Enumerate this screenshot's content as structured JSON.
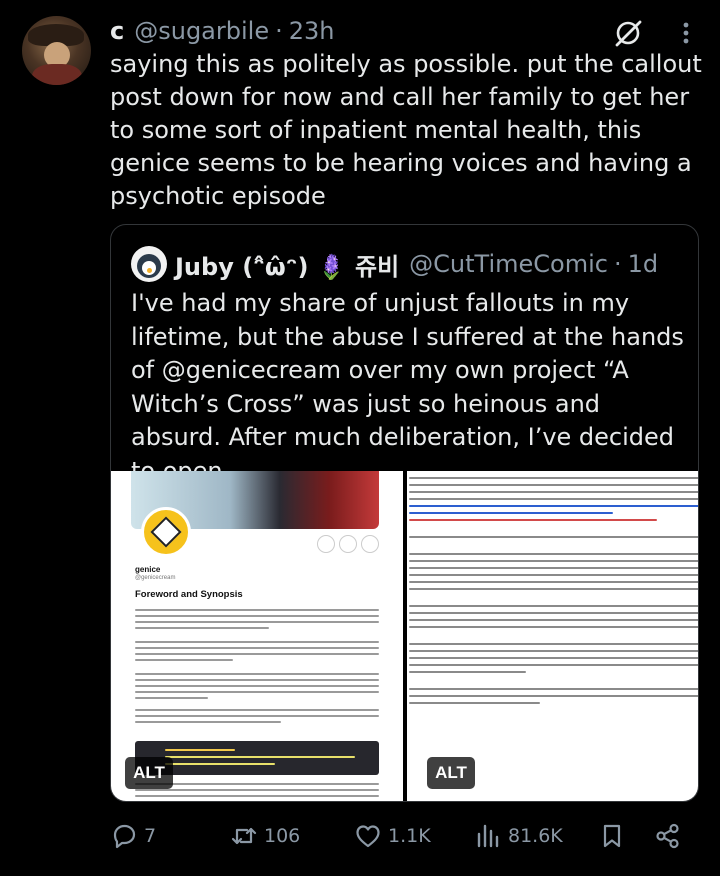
{
  "tweet": {
    "author_name": "c",
    "handle": "@sugarbile",
    "separator": "·",
    "time": "23h",
    "text": "saying this as politely as possible. put the callout post down for now and call her family to get her to some sort of inpatient mental health, this genice seems to be hearing voices and having a psychotic episode"
  },
  "quote": {
    "author_name": "Juby (ᵔ̂ω̂ᵔ) 🪻 쥬비",
    "handle": "@CutTimeComic",
    "separator": "·",
    "time": "1d",
    "text": "I've had my share of unjust fallouts in my lifetime, but the abuse I suffered at the hands of @genicecream over my own project “A Witch’s Cross” was just so heinous and absurd. After much deliberation, I’ve decided to open ...",
    "media": [
      {
        "alt_badge": "ALT",
        "profile_name": "genice",
        "profile_handle": "@genicecream",
        "heading": "Foreword and Synopsis"
      },
      {
        "alt_badge": "ALT"
      }
    ]
  },
  "actions": {
    "replies": "7",
    "reposts": "106",
    "likes": "1.1K",
    "views": "81.6K"
  },
  "colors": {
    "background": "#000000",
    "text_primary": "#e7e9ea",
    "text_secondary": "#8b98a5",
    "border": "#333639"
  },
  "icons": [
    "grok-icon",
    "more-icon",
    "reply-icon",
    "repost-icon",
    "like-icon",
    "views-icon",
    "bookmark-icon",
    "share-icon"
  ]
}
